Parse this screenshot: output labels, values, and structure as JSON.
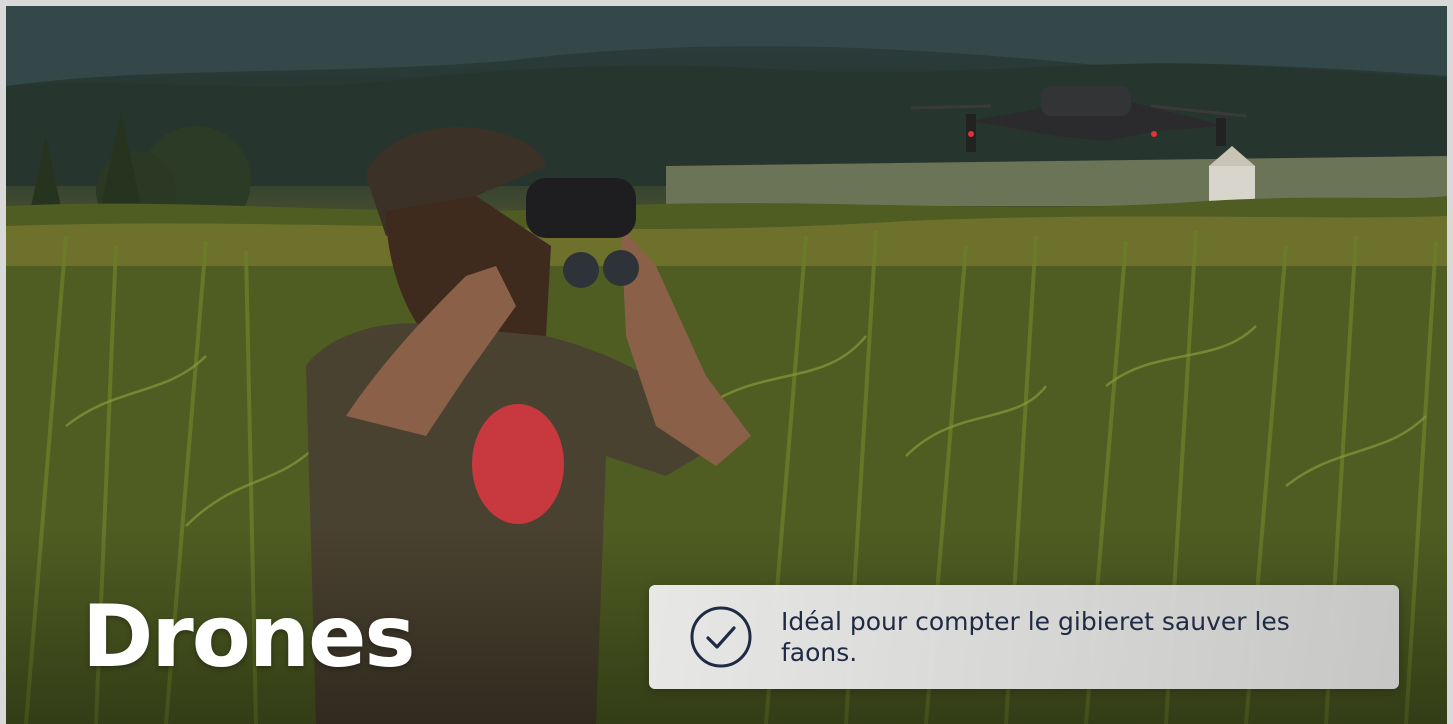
{
  "hero": {
    "title": "Drones",
    "feature_text": "Idéal pour compter le gibieret sauver les faons.",
    "feature_icon": "check-circle-icon"
  },
  "colors": {
    "title": "#ffffff",
    "feature_text": "#1f2a44",
    "feature_background": "#e6e6e6",
    "page_border": "#d9d9d9"
  }
}
